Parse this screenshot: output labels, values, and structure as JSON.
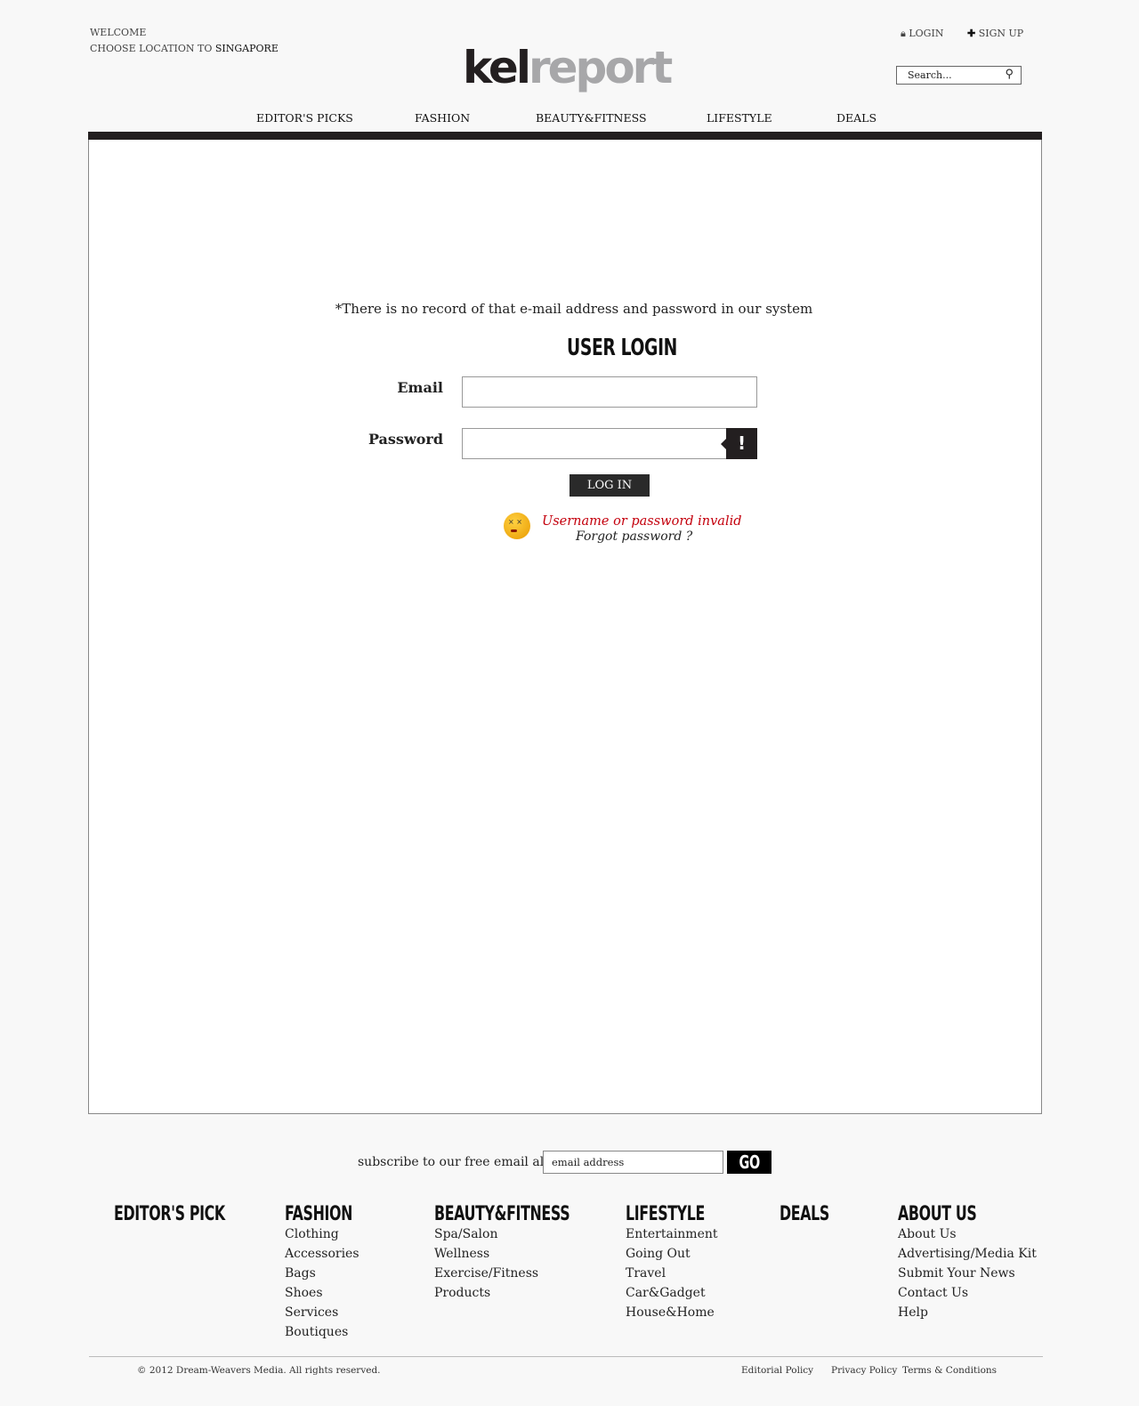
{
  "header": {
    "welcome": "WELCOME",
    "choose_location": "CHOOSE LOCATION TO",
    "location": "SINGAPORE",
    "login": "LOGIN",
    "signup": "SIGN UP",
    "search_placeholder": "Search...",
    "logo_part1": "kel",
    "logo_part2": "report"
  },
  "nav": [
    "EDITOR'S PICKS",
    "FASHION",
    "BEAUTY&FITNESS",
    "LIFESTYLE",
    "DEALS"
  ],
  "login": {
    "notice": "*There is no record of that e-mail address and password in our system",
    "title": "USER LOGIN",
    "email_label": "Email",
    "password_label": "Password",
    "error_badge": "!",
    "button": "LOG IN",
    "error": "Username or password invalid",
    "forgot": "Forgot password ?"
  },
  "subscribe": {
    "label": "subscribe to our free email alerts",
    "placeholder": "email address",
    "button": "GO"
  },
  "footer": {
    "columns": [
      {
        "title": "EDITOR'S PICK",
        "items": []
      },
      {
        "title": "FASHION",
        "items": [
          "Clothing",
          "Accessories",
          "Bags",
          "Shoes",
          "Services",
          "Boutiques"
        ]
      },
      {
        "title": "BEAUTY&FITNESS",
        "items": [
          "Spa/Salon",
          "Wellness",
          "Exercise/Fitness",
          "Products"
        ]
      },
      {
        "title": "LIFESTYLE",
        "items": [
          "Entertainment",
          "Going Out",
          "Travel",
          "Car&Gadget",
          "House&Home"
        ]
      },
      {
        "title": "DEALS",
        "items": []
      },
      {
        "title": "ABOUT US",
        "items": [
          "About Us",
          "Advertising/Media Kit",
          "Submit Your News",
          "Contact Us",
          "Help"
        ]
      }
    ],
    "copyright": "© 2012 Dream-Weavers Media. All rights reserved.",
    "links": [
      "Editorial Policy",
      "Privacy Policy",
      "Terms & Conditions"
    ]
  }
}
